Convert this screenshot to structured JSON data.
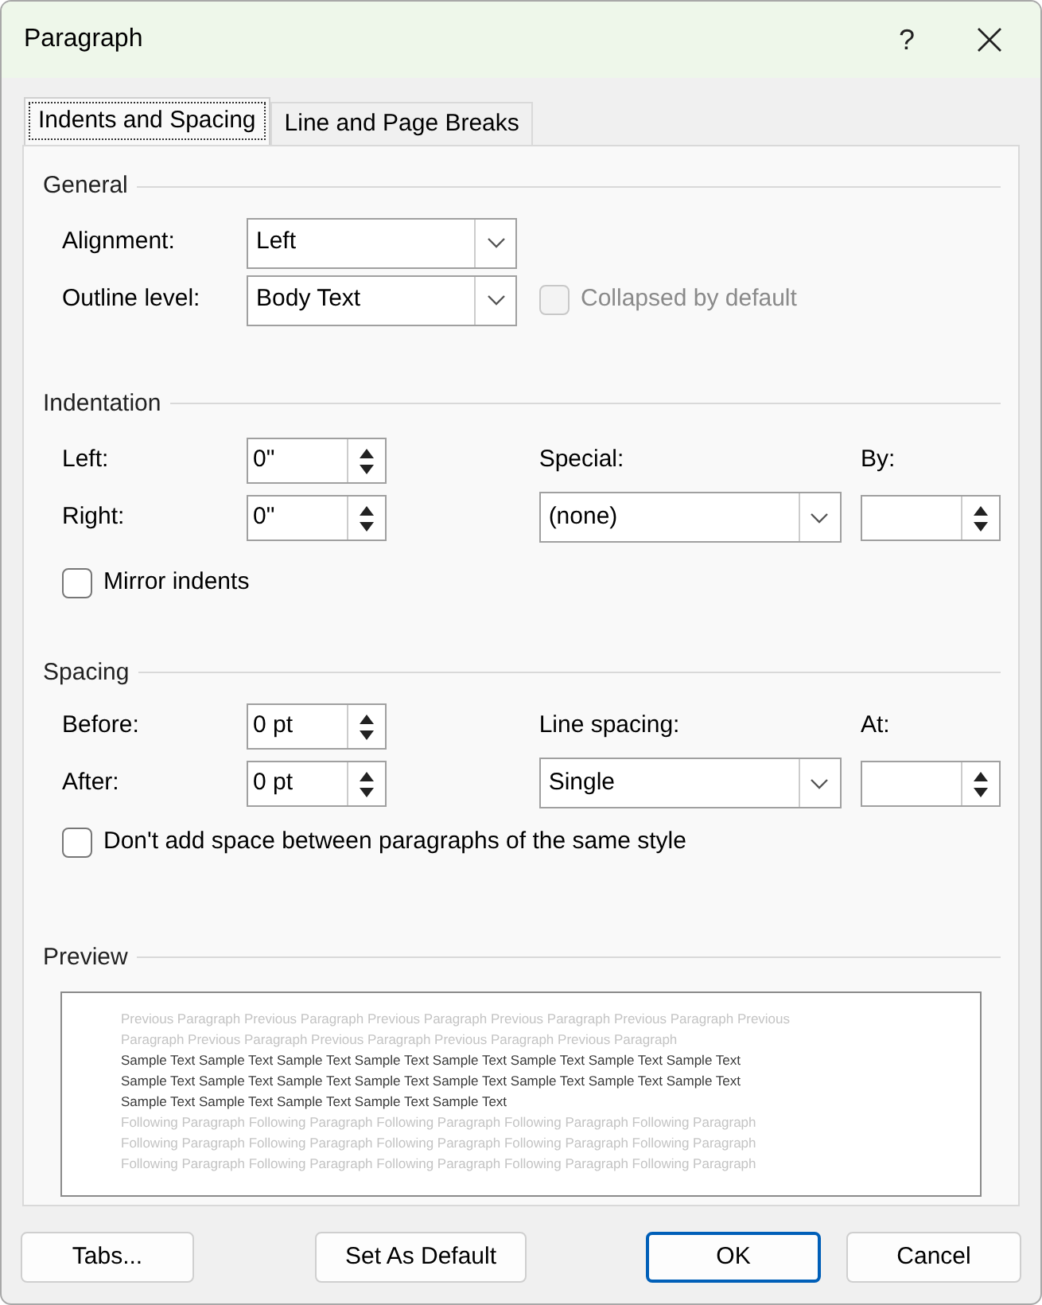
{
  "window": {
    "title": "Paragraph",
    "help": "?"
  },
  "tabs": [
    {
      "label": "Indents and Spacing",
      "selected": true
    },
    {
      "label": "Line and Page Breaks",
      "selected": false
    }
  ],
  "general": {
    "heading": "General",
    "alignment": {
      "label": "Alignment:",
      "value": "Left"
    },
    "outline_level": {
      "label": "Outline level:",
      "value": "Body Text"
    },
    "collapsed": {
      "label": "Collapsed by default",
      "checked": false,
      "disabled": true
    }
  },
  "indentation": {
    "heading": "Indentation",
    "left": {
      "label": "Left:",
      "value": "0\""
    },
    "right": {
      "label": "Right:",
      "value": "0\""
    },
    "special": {
      "label": "Special:",
      "value": "(none)"
    },
    "by": {
      "label": "By:"
    },
    "mirror": {
      "label": "Mirror indents",
      "checked": false,
      "disabled": false
    }
  },
  "spacing": {
    "heading": "Spacing",
    "before": {
      "label": "Before:",
      "value": "0 pt"
    },
    "after": {
      "label": "After:",
      "value": "0 pt"
    },
    "line_spacing": {
      "label": "Line spacing:",
      "value": "Single"
    },
    "at": {
      "label": "At:"
    },
    "dont_add": {
      "label": "Don't add space between paragraphs of the same style",
      "checked": false,
      "disabled": false
    }
  },
  "preview": {
    "heading": "Preview",
    "lines": [
      {
        "kind": "previous",
        "text": "Previous Paragraph Previous Paragraph Previous Paragraph Previous Paragraph Previous Paragraph Previous"
      },
      {
        "kind": "previous",
        "text": "Paragraph Previous Paragraph Previous Paragraph Previous Paragraph Previous Paragraph"
      },
      {
        "kind": "sample",
        "text": "Sample Text Sample Text Sample Text Sample Text Sample Text Sample Text Sample Text Sample Text"
      },
      {
        "kind": "sample",
        "text": "Sample Text Sample Text Sample Text Sample Text Sample Text Sample Text Sample Text Sample Text"
      },
      {
        "kind": "sample",
        "text": "Sample Text Sample Text Sample Text Sample Text Sample Text"
      },
      {
        "kind": "following",
        "text": "Following Paragraph Following Paragraph Following Paragraph Following Paragraph Following Paragraph"
      },
      {
        "kind": "following",
        "text": "Following Paragraph Following Paragraph Following Paragraph Following Paragraph Following Paragraph"
      },
      {
        "kind": "following",
        "text": "Following Paragraph Following Paragraph Following Paragraph Following Paragraph Following Paragraph"
      }
    ]
  },
  "buttons": [
    {
      "label": "Tabs...",
      "primary": false
    },
    {
      "label": "Set As Default",
      "primary": false
    },
    {
      "label": "OK",
      "primary": true
    },
    {
      "label": "Cancel",
      "primary": false
    }
  ]
}
